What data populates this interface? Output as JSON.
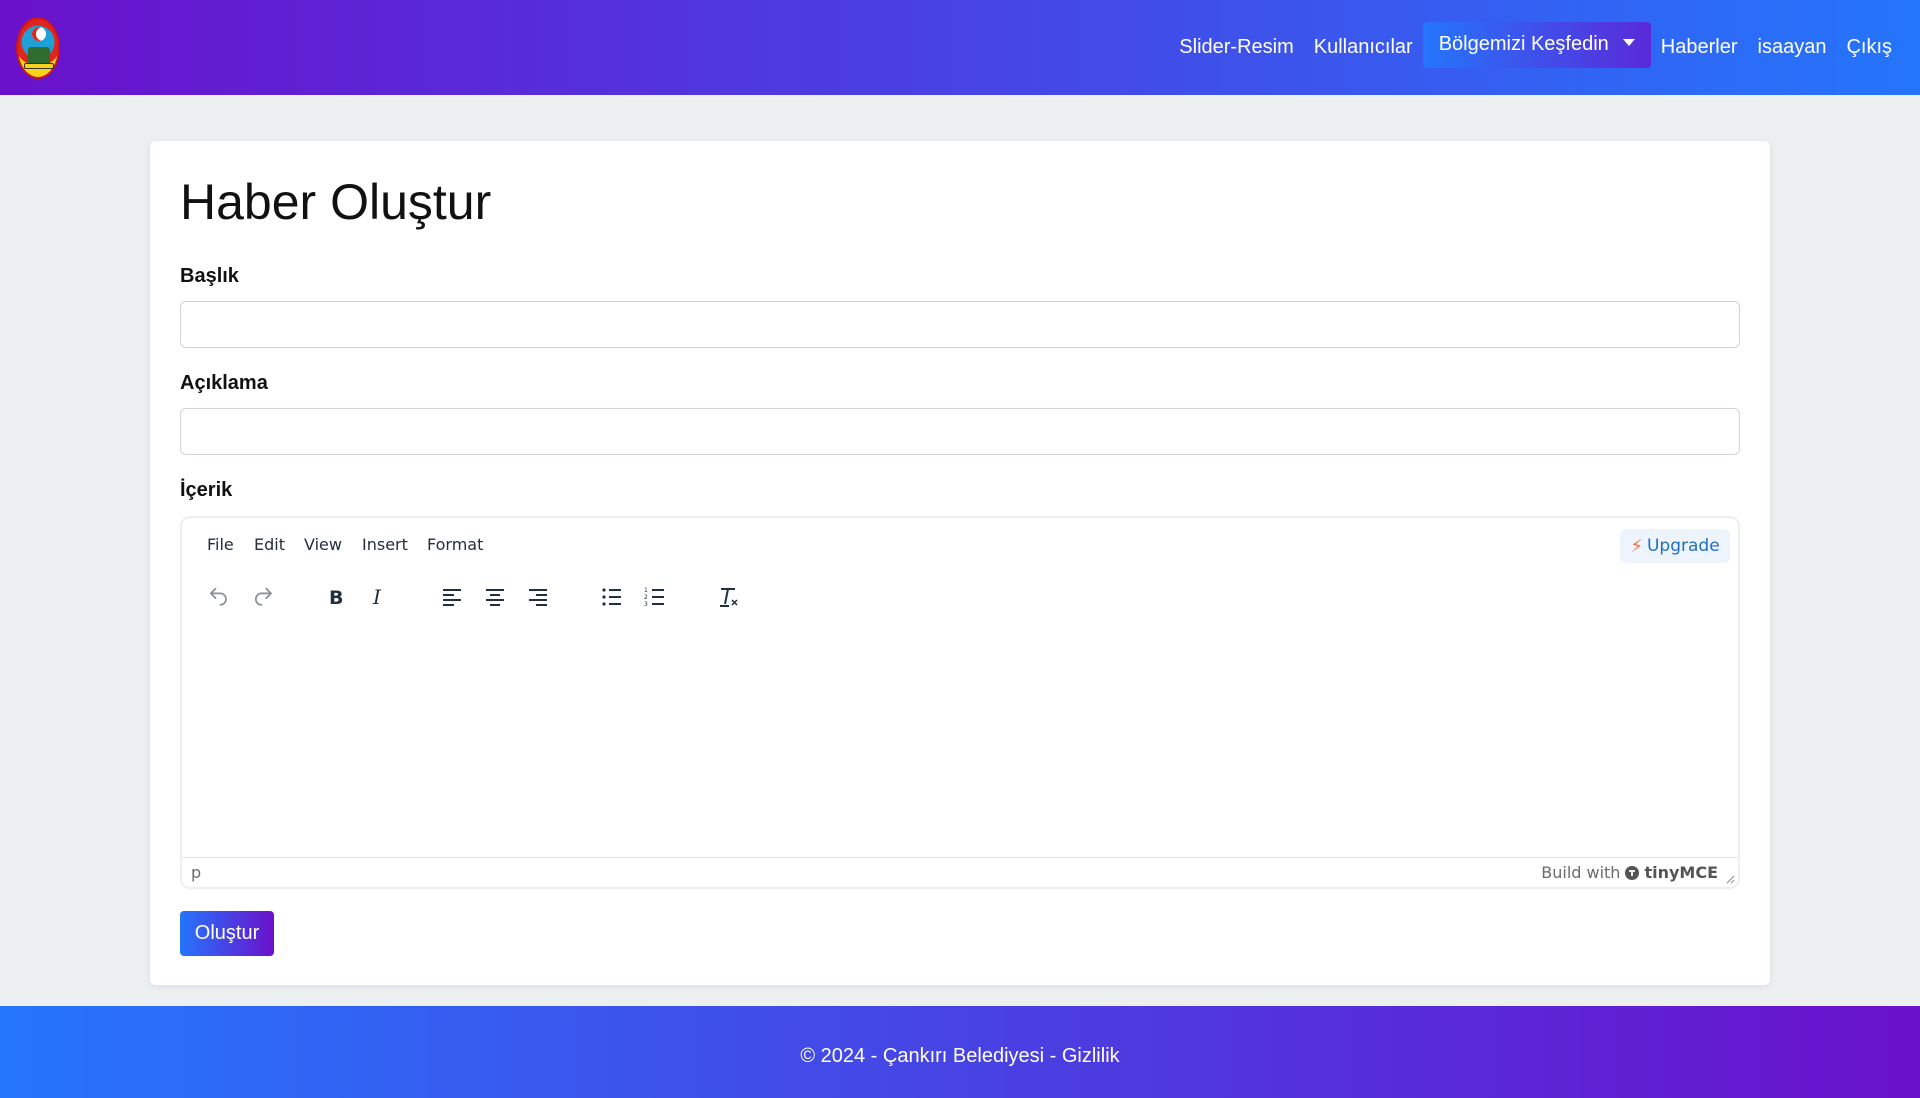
{
  "nav": {
    "logo_alt": "ÇANKIRI",
    "links": [
      "Slider-Resim",
      "Kullanıcılar"
    ],
    "dropdown_label": "Bölgemizi Keşfedin",
    "links_right": [
      "Haberler",
      "isaayan",
      "Çıkış"
    ]
  },
  "form": {
    "title": "Haber Oluştur",
    "baslik_label": "Başlık",
    "aciklama_label": "Açıklama",
    "icerik_label": "İçerik",
    "submit_label": "Oluştur"
  },
  "editor": {
    "menu": [
      "File",
      "Edit",
      "View",
      "Insert",
      "Format"
    ],
    "upgrade_label": "Upgrade",
    "status_path": "p",
    "build_with": "Build with",
    "brand": "tinyMCE",
    "toolbar_icons": [
      "undo-icon",
      "redo-icon",
      "bold-icon",
      "italic-icon",
      "align-left-icon",
      "align-center-icon",
      "align-right-icon",
      "bullet-list-icon",
      "numbered-list-icon",
      "clear-formatting-icon"
    ]
  },
  "footer": {
    "text": "© 2024 - Çankırı Belediyesi - Gizlilik"
  },
  "colors": {
    "gradient_start": "#6a11cb",
    "gradient_end": "#2575fc",
    "page_bg": "#ecf0f1"
  }
}
